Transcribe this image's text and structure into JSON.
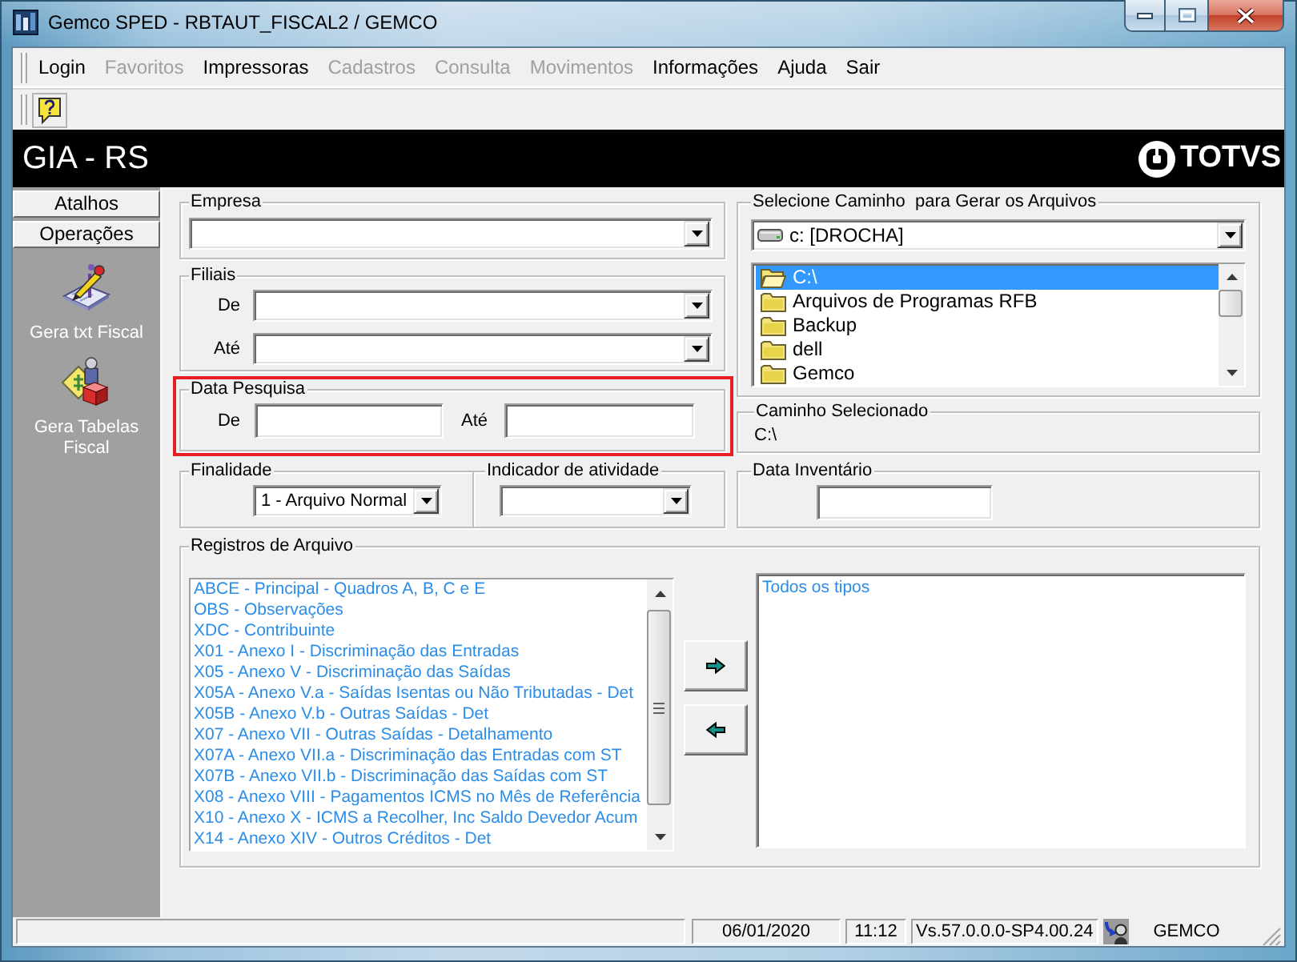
{
  "window": {
    "title": "Gemco SPED - RBTAUT_FISCAL2 / GEMCO"
  },
  "menu": [
    {
      "label": "Login",
      "disabled": false
    },
    {
      "label": "Favoritos",
      "disabled": true
    },
    {
      "label": "Impressoras",
      "disabled": false
    },
    {
      "label": "Cadastros",
      "disabled": true
    },
    {
      "label": "Consulta",
      "disabled": true
    },
    {
      "label": "Movimentos",
      "disabled": true
    },
    {
      "label": "Informações",
      "disabled": false
    },
    {
      "label": "Ajuda",
      "disabled": false
    },
    {
      "label": "Sair",
      "disabled": false
    }
  ],
  "header": {
    "title": "GIA - RS",
    "logo_text": "TOTVS"
  },
  "sidebar": {
    "groups": [
      {
        "label": "Atalhos"
      },
      {
        "label": "Operações"
      }
    ],
    "items": [
      {
        "label": "Gera txt Fiscal",
        "kind": "txt"
      },
      {
        "label": "Gera Tabelas Fiscal",
        "kind": "tables"
      }
    ]
  },
  "form": {
    "empresa": {
      "label": "Empresa"
    },
    "filiais": {
      "label": "Filiais",
      "fields": [
        {
          "label": "De"
        },
        {
          "label": "Até"
        }
      ]
    },
    "data_pesquisa": {
      "label": "Data Pesquisa",
      "highlighted": true,
      "fields": [
        {
          "label": "De"
        },
        {
          "label": "Até"
        }
      ]
    },
    "finalidade": {
      "label": "Finalidade",
      "value": "1 - Arquivo Normal"
    },
    "indicador_atividade": {
      "label": "Indicador de atividade"
    },
    "caminho": {
      "label": "Selecione Caminho  para Gerar os Arquivos",
      "drive": "c: [DROCHA]",
      "folders": [
        {
          "name": "C:\\",
          "selected": true
        },
        {
          "name": "Arquivos de Programas RFB",
          "selected": false
        },
        {
          "name": "Backup",
          "selected": false
        },
        {
          "name": "dell",
          "selected": false
        },
        {
          "name": "Gemco",
          "selected": false
        }
      ]
    },
    "caminho_selecionado": {
      "label": "Caminho Selecionado",
      "value": "C:\\"
    },
    "data_inventario": {
      "label": "Data Inventário"
    },
    "registros": {
      "label": "Registros de Arquivo",
      "available": [
        {
          "text": "ABCE - Principal - Quadros A, B, C e E",
          "selected": false
        },
        {
          "text": "OBS - Observações",
          "selected": false
        },
        {
          "text": "XDC - Contribuinte",
          "selected": false
        },
        {
          "text": "X01 - Anexo I - Discriminação das Entradas",
          "selected": false
        },
        {
          "text": "X05 - Anexo V - Discriminação das Saídas",
          "selected": false
        },
        {
          "text": "X05A - Anexo V.a - Saídas Isentas ou Não Tributadas - Det",
          "selected": false
        },
        {
          "text": "X05B - Anexo V.b - Outras Saídas - Det",
          "selected": false
        },
        {
          "text": "X07 - Anexo VII - Outras Saídas - Detalhamento",
          "selected": false
        },
        {
          "text": "X07A - Anexo VII.a - Discriminação das Entradas com ST",
          "selected": false
        },
        {
          "text": "X07B - Anexo VII.b - Discriminação das Saídas com ST",
          "selected": false
        },
        {
          "text": "X08 - Anexo VIII - Pagamentos ICMS no Mês de Referência",
          "selected": false
        },
        {
          "text": "X10 - Anexo X - ICMS a Recolher, Inc Saldo Devedor Acum",
          "selected": false
        },
        {
          "text": "X14 - Anexo XIV - Outros Créditos - Det",
          "selected": false
        }
      ],
      "chosen": [
        {
          "text": "Todos os tipos",
          "selected": false
        }
      ]
    }
  },
  "status_bar": {
    "date": "06/01/2020",
    "time": "11:12",
    "version": "Vs.57.0.0.0-SP4.00.24",
    "user": "GEMCO"
  }
}
